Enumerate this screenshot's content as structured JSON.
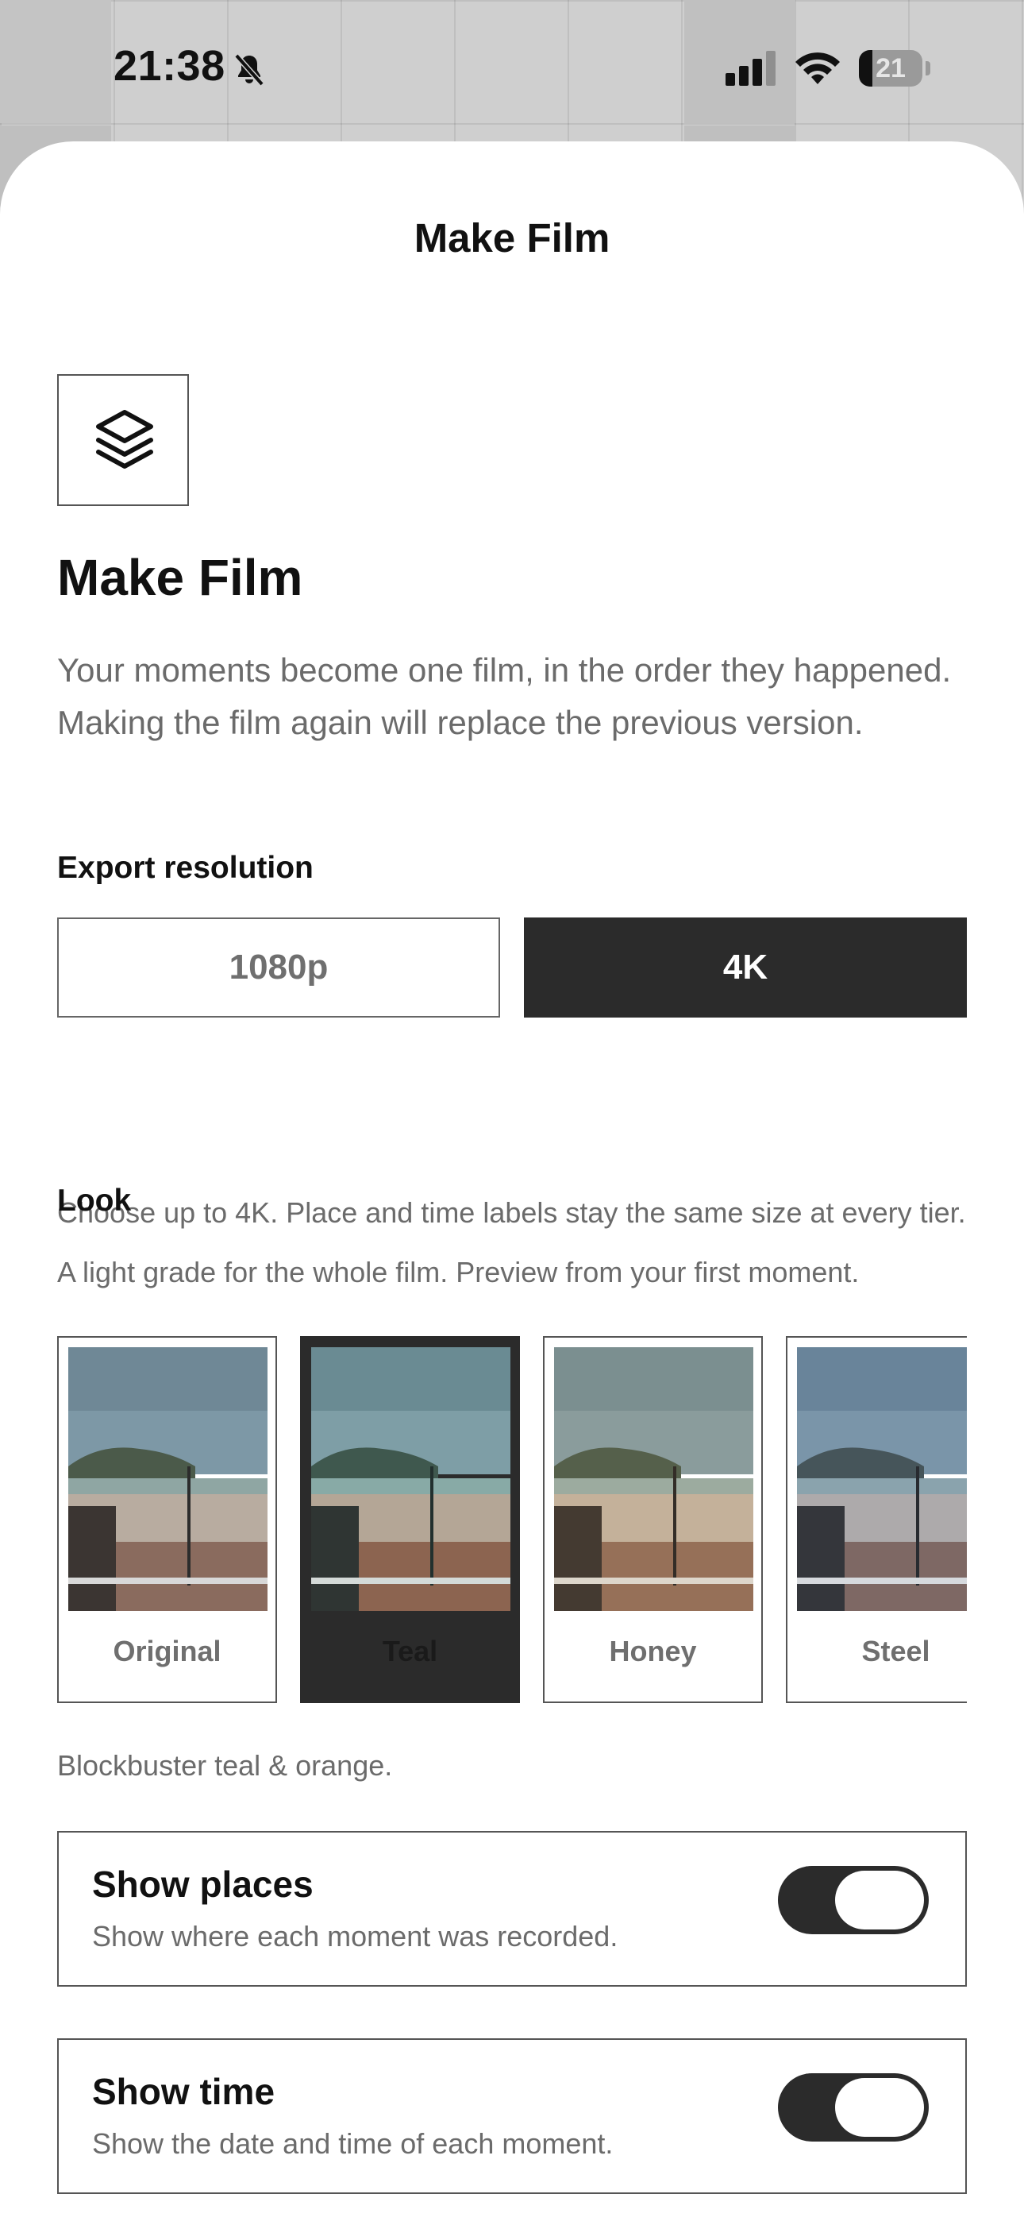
{
  "status_bar": {
    "time": "21:38",
    "battery_level": "21",
    "battery_fraction": 0.21
  },
  "sheet": {
    "title": "Make Film",
    "icon": "layers-icon",
    "heading": "Make Film",
    "intro": "Your moments become one film, in the order they happened. Making the film again will replace the previous version."
  },
  "export": {
    "label": "Export resolution",
    "options": [
      "1080p",
      "4K"
    ],
    "selected": "4K",
    "helper": "Choose up to 4K. Place and time labels stay the same size at every tier."
  },
  "look": {
    "label": "Look",
    "helper": "A light grade for the whole film. Preview from your first moment.",
    "options": [
      "Original",
      "Teal",
      "Honey",
      "Steel"
    ],
    "selected": "Teal",
    "description": "Blockbuster teal & orange."
  },
  "toggles": {
    "places": {
      "title": "Show places",
      "subtitle": "Show where each moment was recorded.",
      "on": true
    },
    "time": {
      "title": "Show time",
      "subtitle": "Show the date and time of each moment.",
      "on": true
    }
  },
  "colors": {
    "accent_dark": "#2b2b2b",
    "text_secondary": "#6b6b6b",
    "sheet_background": "#ffffff"
  }
}
